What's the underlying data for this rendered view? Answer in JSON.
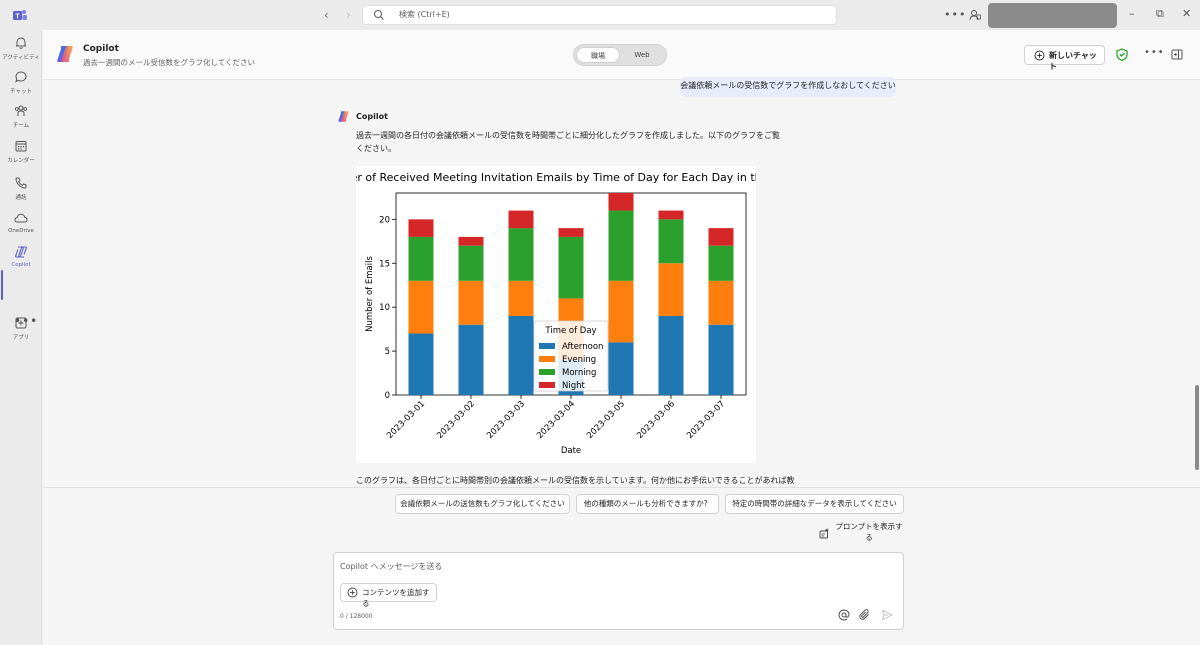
{
  "titlebar": {
    "search_placeholder": "検索 (Ctrl+E)",
    "window_controls": [
      "minimize-icon",
      "restore-icon",
      "close-icon"
    ]
  },
  "rail": {
    "items": [
      {
        "label": "アクティビティ",
        "icon": "bell-icon"
      },
      {
        "label": "チャット",
        "icon": "chat-icon"
      },
      {
        "label": "チーム",
        "icon": "teams-icon"
      },
      {
        "label": "カレンダー",
        "icon": "calendar-icon"
      },
      {
        "label": "通話",
        "icon": "phone-icon"
      },
      {
        "label": "OneDrive",
        "icon": "cloud-icon"
      },
      {
        "label": "Copilot",
        "icon": "copilot-icon"
      },
      {
        "label": "アプリ",
        "icon": "add-apps-icon"
      }
    ],
    "more": "•••",
    "active_index": 6
  },
  "header": {
    "title": "Copilot",
    "subtitle": "過去一週間のメール受信数をグラフ化してください",
    "toggle_work": "職場",
    "toggle_web": "Web",
    "new_chat": "新しいチャット"
  },
  "chat": {
    "user_message": "会議依頼メールの受信数でグラフを作成しなおしてください",
    "bot_name": "Copilot",
    "bot_text": "過去一週間の各日付の会議依頼メールの受信数を時間帯ごとに細分化したグラフを作成しました。以下のグラフをご覧ください。",
    "bot_footer": "このグラフは、各日付ごとに時間帯別の会議依頼メールの受信数を示しています。何か他にお手伝いできることがあれば教えてく"
  },
  "suggestions": [
    "会議依頼メールの送信数もグラフ化してください",
    "他の種類のメールも分析できますか？",
    "特定の時間帯の詳細なデータを表示してください"
  ],
  "show_prompts": "プロンプトを表示する",
  "composer": {
    "placeholder": "Copilot へメッセージを送る",
    "add_content": "コンテンツを追加する",
    "counter": "0 / 128000"
  },
  "colors": {
    "accent": "#5b5fc7",
    "afternoon": "#1f77b4",
    "evening": "#ff7f0e",
    "morning": "#2ca02c",
    "night": "#d62728"
  },
  "chart_data": {
    "type": "bar",
    "stacked": true,
    "title": "per of Received Meeting Invitation Emails by Time of Day for Each Day in the",
    "xlabel": "Date",
    "ylabel": "Number of Emails",
    "ylim": [
      0,
      23
    ],
    "yticks": [
      0,
      5,
      10,
      15,
      20
    ],
    "categories": [
      "2023-03-01",
      "2023-03-02",
      "2023-03-03",
      "2023-03-04",
      "2023-03-05",
      "2023-03-06",
      "2023-03-07"
    ],
    "legend_title": "Time of Day",
    "legend_position": "lower-center",
    "series": [
      {
        "name": "Afternoon",
        "color": "#1f77b4",
        "values": [
          7,
          8,
          9,
          4,
          6,
          9,
          8
        ]
      },
      {
        "name": "Evening",
        "color": "#ff7f0e",
        "values": [
          6,
          5,
          4,
          7,
          7,
          6,
          5
        ]
      },
      {
        "name": "Morning",
        "color": "#2ca02c",
        "values": [
          5,
          4,
          6,
          7,
          8,
          5,
          4
        ]
      },
      {
        "name": "Night",
        "color": "#d62728",
        "values": [
          2,
          1,
          2,
          1,
          2,
          1,
          2
        ]
      }
    ]
  }
}
